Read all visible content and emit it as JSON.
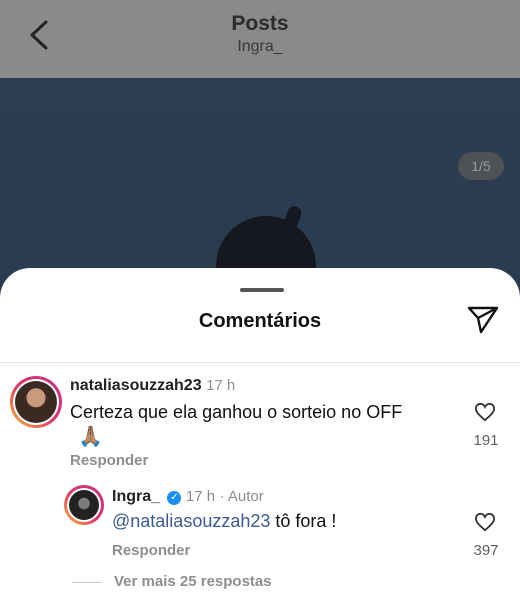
{
  "header": {
    "title": "Posts",
    "subtitle": "Ingra_"
  },
  "post": {
    "counter": "1/5"
  },
  "comments_sheet": {
    "title": "Comentários",
    "comments": [
      {
        "username": "nataliasouzzah23",
        "time": "17 h",
        "text": "Certeza que ela ganhou o sorteio no OFF",
        "emoji": "🙏🏽",
        "reply_label": "Responder",
        "likes": "191"
      }
    ],
    "reply": {
      "username": "Ingra_",
      "time": "17 h",
      "author_label": "· Autor",
      "mention": "@nataliasouzzah23",
      "text": " tô fora !",
      "reply_label": "Responder",
      "likes": "397"
    },
    "more_replies": "Ver mais 25 respostas"
  },
  "icons": {
    "back": "chevron-left-icon",
    "send": "send-icon",
    "heart": "heart-outline-icon",
    "verified": "verified-badge-icon"
  }
}
